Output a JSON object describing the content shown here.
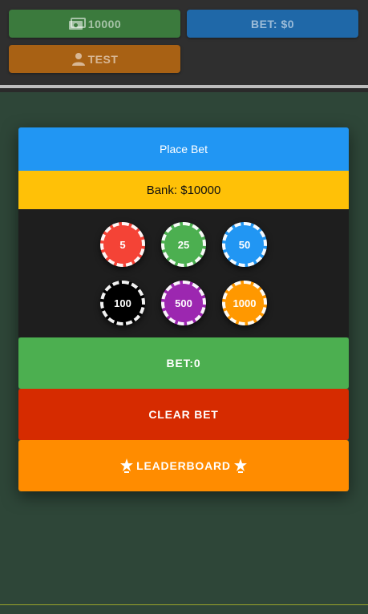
{
  "header": {
    "money_label": "10000",
    "bet_label": "BET: $0",
    "user_label": "TEST"
  },
  "panel": {
    "title": "Place Bet",
    "bank_label": "Bank: $10000",
    "chips": [
      {
        "label": "5",
        "color": "#f44336"
      },
      {
        "label": "25",
        "color": "#4caf50"
      },
      {
        "label": "50",
        "color": "#2196f3"
      },
      {
        "label": "100",
        "color": "#000000"
      },
      {
        "label": "500",
        "color": "#9c27b0"
      },
      {
        "label": "1000",
        "color": "#ff9800"
      }
    ],
    "bet_label": "BET:0",
    "clear_label": "CLEAR BET",
    "leaderboard_label": "LEADERBOARD"
  },
  "colors": {
    "background": "#2e4638",
    "topbar": "#2f2f2f"
  }
}
